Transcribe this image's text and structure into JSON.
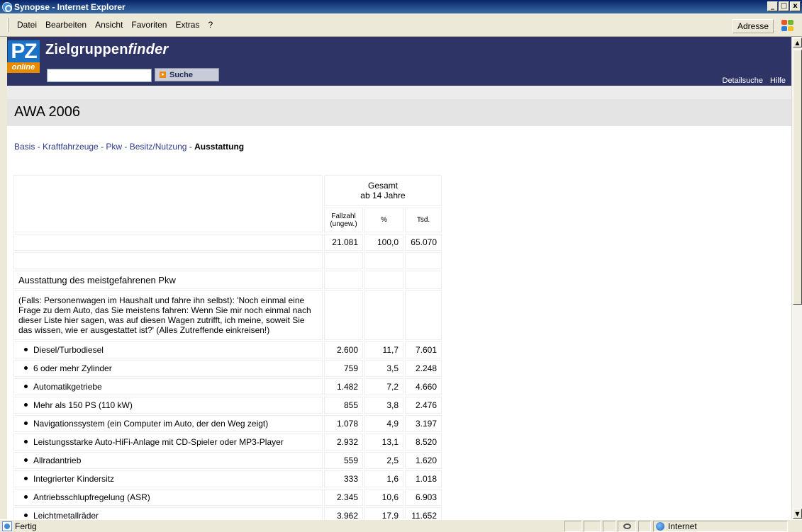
{
  "window": {
    "title": "Synopse - Internet Explorer",
    "buttons": [
      "_",
      "□",
      "x"
    ]
  },
  "menu": {
    "items": [
      "Datei",
      "Bearbeiten",
      "Ansicht",
      "Favoriten",
      "Extras",
      "?"
    ],
    "address_label": "Adresse"
  },
  "header": {
    "logo_pz": "PZ",
    "logo_online": "online",
    "title_main": "Zielgruppen",
    "title_italic": "finder",
    "search": {
      "value": "",
      "placeholder": ""
    },
    "search_button": "Suche",
    "links": [
      "Detailsuche",
      "Hilfe"
    ],
    "colors": {
      "banner": "#2e3566",
      "accent": "#f08a00",
      "logo": "#1a73c7"
    }
  },
  "page": {
    "title": "AWA 2006",
    "breadcrumb": [
      "Basis",
      "Kraftfahrzeuge",
      "Pkw",
      "Besitz/Nutzung"
    ],
    "breadcrumb_current": "Ausstattung"
  },
  "table": {
    "group_header_line1": "Gesamt",
    "group_header_line2": "ab 14 Jahre",
    "col_fallzahl_line1": "Fallzahl",
    "col_fallzahl_line2": "(ungew.)",
    "col_percent": "%",
    "col_tsd": "Tsd.",
    "total": {
      "fallzahl": "21.081",
      "percent": "100,0",
      "tsd": "65.070"
    },
    "section_title": "Ausstattung des meistgefahrenen Pkw",
    "question": "(Falls: Personenwagen im Haushalt und fahre ihn selbst): 'Noch einmal eine Frage zu dem Auto, das Sie meistens fahren: Wenn Sie mir noch einmal nach dieser Liste hier sagen, was auf diesen Wagen zutrifft, ich meine, soweit Sie das wissen, wie er ausgestattet ist?' (Alles Zutreffende einkreisen!)",
    "rows": [
      {
        "label": "Diesel/Turbodiesel",
        "fallzahl": "2.600",
        "percent": "11,7",
        "tsd": "7.601"
      },
      {
        "label": "6 oder mehr Zylinder",
        "fallzahl": "759",
        "percent": "3,5",
        "tsd": "2.248"
      },
      {
        "label": "Automatikgetriebe",
        "fallzahl": "1.482",
        "percent": "7,2",
        "tsd": "4.660"
      },
      {
        "label": "Mehr als 150 PS (110 kW)",
        "fallzahl": "855",
        "percent": "3,8",
        "tsd": "2.476"
      },
      {
        "label": "Navigationssystem (ein Computer im Auto, der den Weg zeigt)",
        "fallzahl": "1.078",
        "percent": "4,9",
        "tsd": "3.197"
      },
      {
        "label": "Leistungsstarke Auto-HiFi-Anlage mit CD-Spieler oder MP3-Player",
        "fallzahl": "2.932",
        "percent": "13,1",
        "tsd": "8.520"
      },
      {
        "label": "Allradantrieb",
        "fallzahl": "559",
        "percent": "2,5",
        "tsd": "1.620"
      },
      {
        "label": "Integrierter Kindersitz",
        "fallzahl": "333",
        "percent": "1,6",
        "tsd": "1.018"
      },
      {
        "label": "Antriebsschlupfregelung (ASR)",
        "fallzahl": "2.345",
        "percent": "10,6",
        "tsd": "6.903"
      },
      {
        "label": "Leichtmetallräder",
        "fallzahl": "3.962",
        "percent": "17,9",
        "tsd": "11.652"
      }
    ]
  },
  "statusbar": {
    "status_text": "Fertig",
    "zone": "Internet"
  }
}
